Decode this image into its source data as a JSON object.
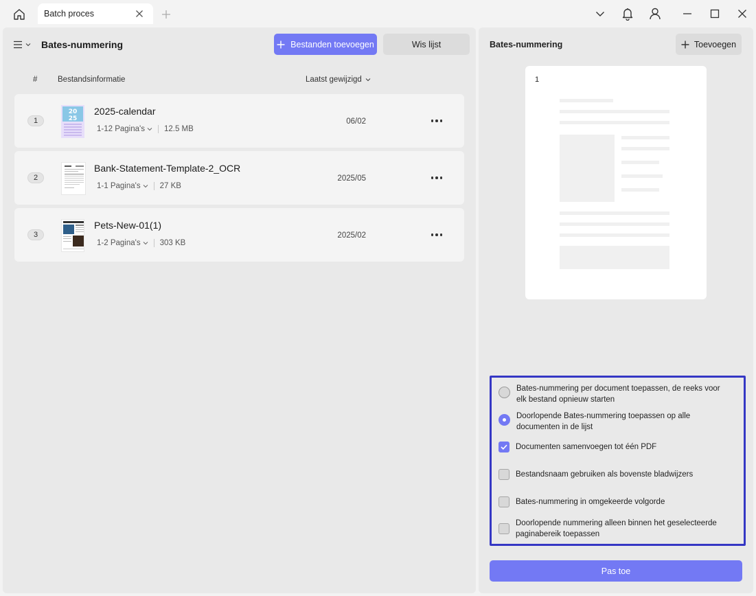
{
  "tab": {
    "title": "Batch proces"
  },
  "header": {
    "title": "Bates-nummering",
    "add_files_label": "Bestanden toevoegen",
    "clear_list_label": "Wis lijst"
  },
  "table": {
    "col_number": "#",
    "col_info": "Bestandsinformatie",
    "col_modified": "Laatst gewijzigd",
    "rows": [
      {
        "index": "1",
        "name": "2025-calendar",
        "pages": "1-12 Pagina's",
        "size": "12.5 MB",
        "date": "06/02"
      },
      {
        "index": "2",
        "name": "Bank-Statement-Template-2_OCR",
        "pages": "1-1 Pagina's",
        "size": "27 KB",
        "date": "2025/05"
      },
      {
        "index": "3",
        "name": "Pets-New-01(1)",
        "pages": "1-2 Pagina's",
        "size": "303 KB",
        "date": "2025/02"
      }
    ]
  },
  "right_panel": {
    "title": "Bates-nummering",
    "add_label": "Toevoegen",
    "preview_number": "1",
    "options": [
      {
        "type": "radio",
        "checked": false,
        "label": "Bates-nummering per document toepassen, de reeks voor elk bestand opnieuw starten"
      },
      {
        "type": "radio",
        "checked": true,
        "label": "Doorlopende Bates-nummering toepassen op alle documenten in de lijst"
      },
      {
        "type": "checkbox",
        "checked": true,
        "label": "Documenten samenvoegen tot één PDF"
      },
      {
        "type": "checkbox",
        "checked": false,
        "label": "Bestandsnaam gebruiken als bovenste bladwijzers"
      },
      {
        "type": "checkbox",
        "checked": false,
        "label": "Bates-nummering in omgekeerde volgorde"
      },
      {
        "type": "checkbox",
        "checked": false,
        "label": "Doorlopende nummering alleen binnen het geselecteerde paginabereik toepassen"
      }
    ],
    "apply_label": "Pas toe"
  },
  "icons": {
    "home": "home-icon",
    "close": "close-icon",
    "plus": "plus-icon",
    "chevron": "chevron-down-icon",
    "bell": "bell-icon",
    "user": "user-icon",
    "minimize": "minimize-icon",
    "maximize": "maximize-icon",
    "menu": "menu-icon",
    "more": "more-icon"
  },
  "colors": {
    "accent": "#7379f4",
    "highlight_border": "#3537c4"
  }
}
